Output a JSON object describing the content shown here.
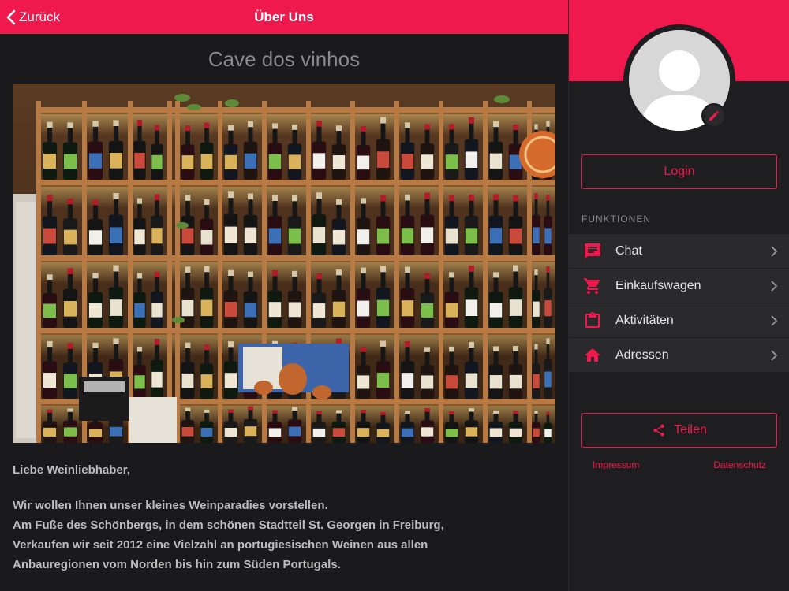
{
  "topbar": {
    "back_label": "Zurück",
    "title": "Über Uns"
  },
  "content": {
    "heading": "Cave dos vinhos",
    "greeting": "Liebe Weinliebhaber,",
    "lines": [
      "Wir wollen Ihnen unser kleines Weinparadies vorstellen.",
      "Am Fuße des Schönbergs, in dem schönen Stadtteil St. Georgen in Freiburg,",
      "Verkaufen wir seit 2012 eine Vielzahl an portugiesischen Weinen aus allen",
      "Anbauregionen vom Norden bis hin zum Süden Portugals."
    ]
  },
  "sidebar": {
    "login_label": "Login",
    "section_label": "FUNKTIONEN",
    "items": [
      {
        "label": "Chat",
        "icon": "chat-icon"
      },
      {
        "label": "Einkaufswagen",
        "icon": "cart-icon"
      },
      {
        "label": "Aktivitäten",
        "icon": "clipboard-icon"
      },
      {
        "label": "Adressen",
        "icon": "home-icon"
      }
    ],
    "share_label": "Teilen",
    "impressum_label": "Impressum",
    "datenschutz_label": "Datenschutz"
  },
  "colors": {
    "accent": "#f0194e",
    "background": "#1a1a1c",
    "menu_bg": "#2a2a2c"
  }
}
